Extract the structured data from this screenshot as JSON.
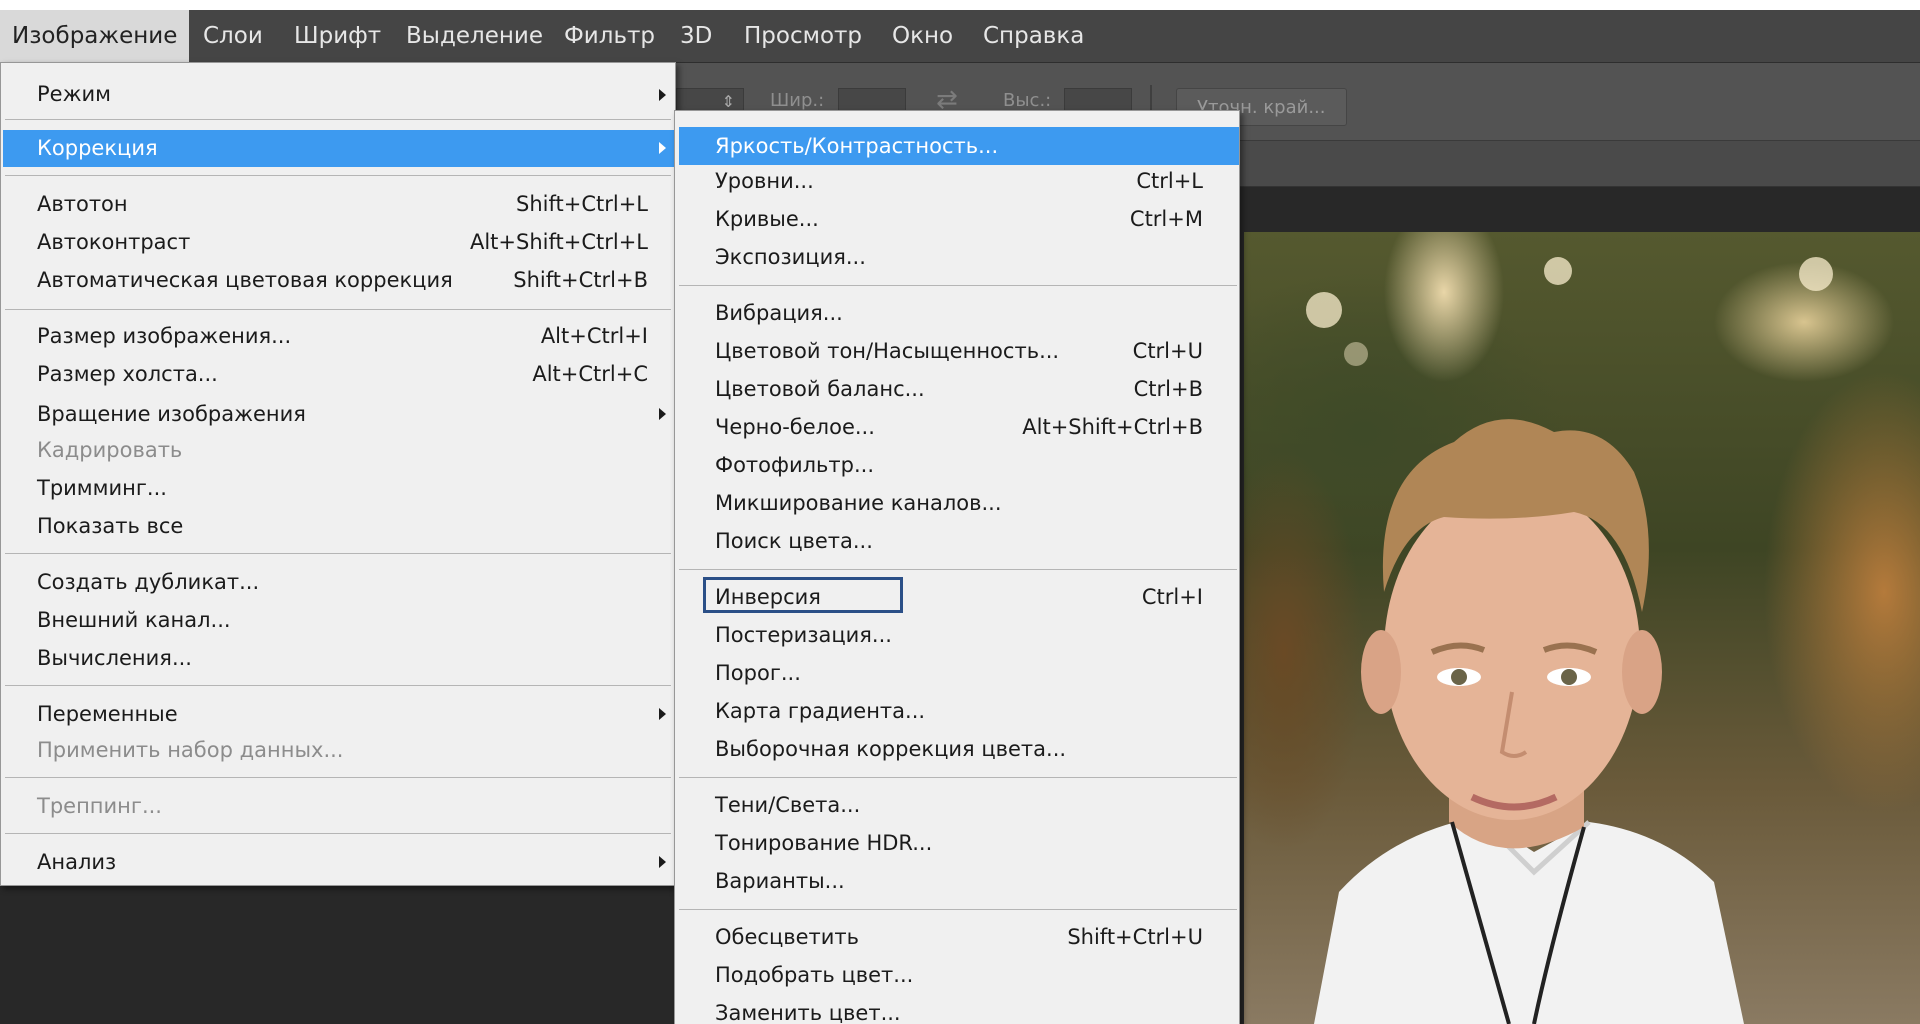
{
  "menubar": {
    "items": [
      "Изображение",
      "Слои",
      "Шрифт",
      "Выделение",
      "Фильтр",
      "3D",
      "Просмотр",
      "Окно",
      "Справка"
    ]
  },
  "options_bar": {
    "width_label": "Шир.:",
    "height_label": "Выс.:",
    "refine_edge_button": "Уточн. край..."
  },
  "image_menu": {
    "items": [
      {
        "label": "Режим",
        "submenu": true
      },
      {
        "label": "Коррекция",
        "submenu": true,
        "highlighted": true
      },
      {
        "label": "Автотон",
        "shortcut": "Shift+Ctrl+L"
      },
      {
        "label": "Автоконтраст",
        "shortcut": "Alt+Shift+Ctrl+L"
      },
      {
        "label": "Автоматическая цветовая коррекция",
        "shortcut": "Shift+Ctrl+B"
      },
      {
        "label": "Размер изображения...",
        "shortcut": "Alt+Ctrl+I"
      },
      {
        "label": "Размер холста...",
        "shortcut": "Alt+Ctrl+C"
      },
      {
        "label": "Вращение изображения",
        "submenu": true
      },
      {
        "label": "Кадрировать",
        "disabled": true
      },
      {
        "label": "Тримминг..."
      },
      {
        "label": "Показать все"
      },
      {
        "label": "Создать дубликат..."
      },
      {
        "label": "Внешний канал..."
      },
      {
        "label": "Вычисления..."
      },
      {
        "label": "Переменные",
        "submenu": true
      },
      {
        "label": "Применить набор данных...",
        "disabled": true
      },
      {
        "label": "Треппинг...",
        "disabled": true
      },
      {
        "label": "Анализ",
        "submenu": true
      }
    ]
  },
  "correction_submenu": {
    "items": [
      {
        "label": "Яркость/Контрастность...",
        "highlighted": true
      },
      {
        "label": "Уровни...",
        "shortcut": "Ctrl+L"
      },
      {
        "label": "Кривые...",
        "shortcut": "Ctrl+M"
      },
      {
        "label": "Экспозиция..."
      },
      {
        "label": "Вибрация..."
      },
      {
        "label": "Цветовой тон/Насыщенность...",
        "shortcut": "Ctrl+U"
      },
      {
        "label": "Цветовой баланс...",
        "shortcut": "Ctrl+B"
      },
      {
        "label": "Черно-белое...",
        "shortcut": "Alt+Shift+Ctrl+B"
      },
      {
        "label": "Фотофильтр..."
      },
      {
        "label": "Микширование каналов..."
      },
      {
        "label": "Поиск цвета..."
      },
      {
        "label": "Инверсия",
        "shortcut": "Ctrl+I",
        "outlined": true
      },
      {
        "label": "Постеризация..."
      },
      {
        "label": "Порог..."
      },
      {
        "label": "Карта градиента..."
      },
      {
        "label": "Выборочная коррекция цвета..."
      },
      {
        "label": "Тени/Света..."
      },
      {
        "label": "Тонирование HDR..."
      },
      {
        "label": "Варианты..."
      },
      {
        "label": "Обесцветить",
        "shortcut": "Shift+Ctrl+U"
      },
      {
        "label": "Подобрать цвет..."
      },
      {
        "label": "Заменить цвет..."
      }
    ]
  },
  "colors": {
    "highlight": "#3d9af0",
    "menu_bg": "#f0f0f0",
    "app_bg": "#535353",
    "outline": "#2b4f87"
  }
}
